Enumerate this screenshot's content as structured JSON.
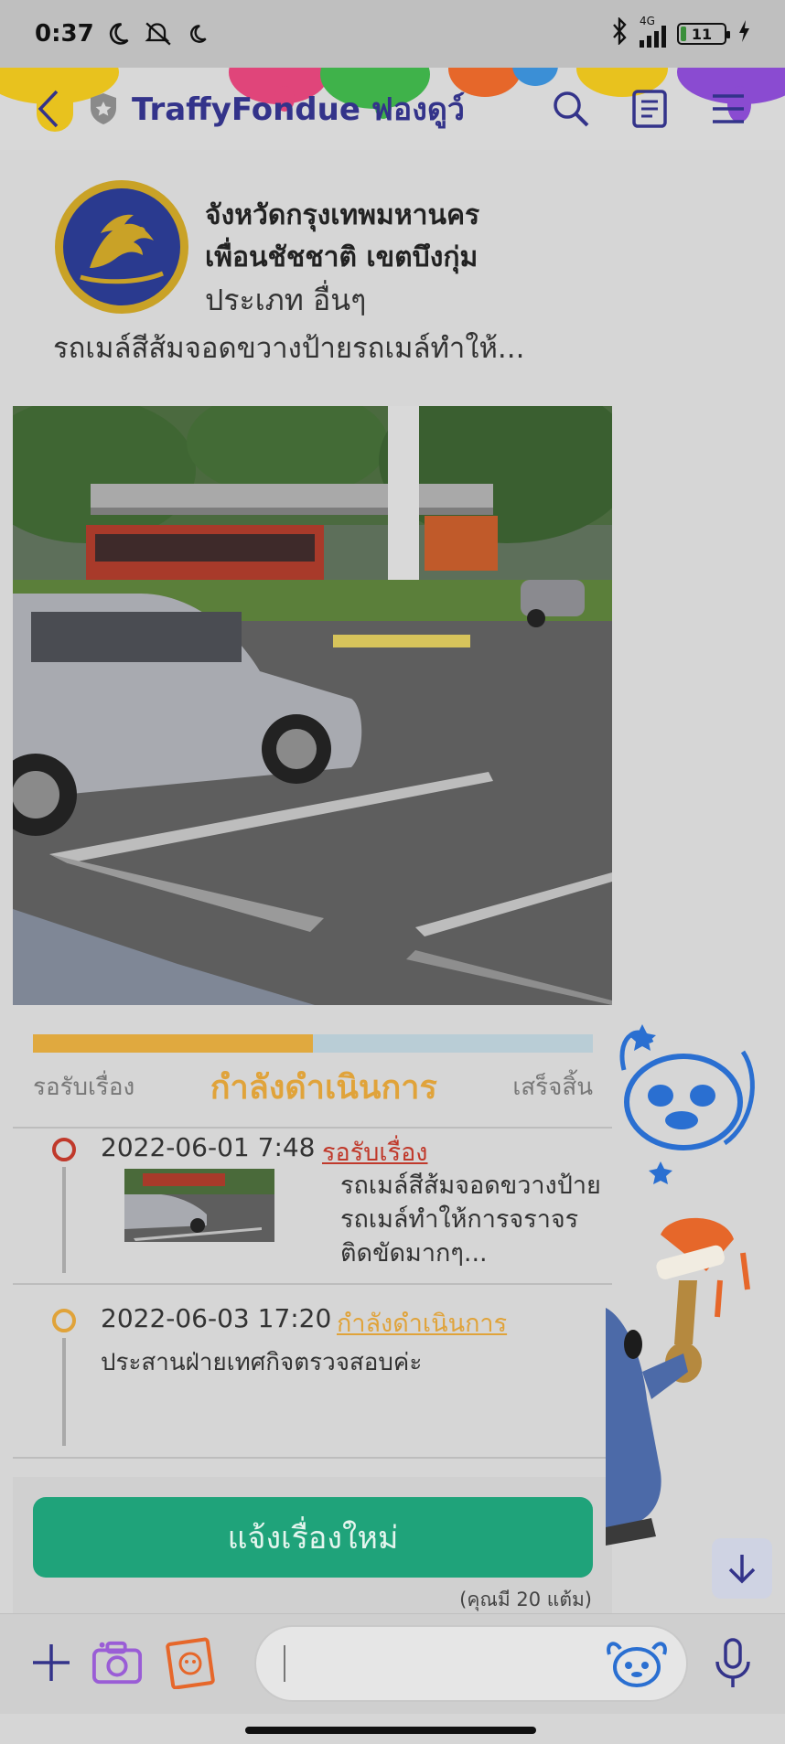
{
  "status_bar": {
    "time": "0:37",
    "network": "4G",
    "battery": "11"
  },
  "header": {
    "title": "TraffyFondue ฟองดูว์"
  },
  "report": {
    "org_name_line1": "จังหวัดกรุงเทพมหานคร",
    "org_name_line2": "เพื่อนชัชชาติ เขตบึงกุ่ม",
    "category": "ประเภท อื่นๆ",
    "headline": "รถเมล์สีส้มจอดขวางป้ายรถเมล์ทำให้..."
  },
  "progress": {
    "fraction_done": 0.5,
    "steps": [
      "รอรับเรื่อง",
      "กำลังดำเนินการ",
      "เสร็จสิ้น"
    ]
  },
  "timeline": [
    {
      "date": "2022-06-01 7:48",
      "status": "รอรับเรื่อง",
      "status_color": "#c0392b",
      "description": "รถเมล์สีส้มจอดขวางป้ายรถเมล์ทำให้การจราจรติดขัดมากๆ..."
    },
    {
      "date": "2022-06-03 17:20",
      "status": "กำลังดำเนินการ",
      "status_color": "#e0a33a",
      "note": "ประสานฝ่ายเทศกิจตรวจสอบค่ะ"
    }
  ],
  "actions": {
    "new_report_label": "แจ้งเรื่องใหม่",
    "points_text": "(คุณมี 20 แต้ม)"
  },
  "input": {
    "placeholder": ""
  },
  "colors": {
    "accent_title": "#33338a",
    "in_progress": "#e0a33a",
    "pending": "#c0392b",
    "button_green": "#1fa37a"
  },
  "icons": [
    "moon-icon",
    "mute-icon",
    "bluetooth-icon",
    "signal-icon",
    "battery-icon",
    "charging-icon",
    "back-icon",
    "shield-icon",
    "search-icon",
    "notes-icon",
    "menu-icon",
    "plus-icon",
    "camera-icon",
    "photo-icon",
    "sticker-icon",
    "mic-icon",
    "arrow-down-icon"
  ]
}
